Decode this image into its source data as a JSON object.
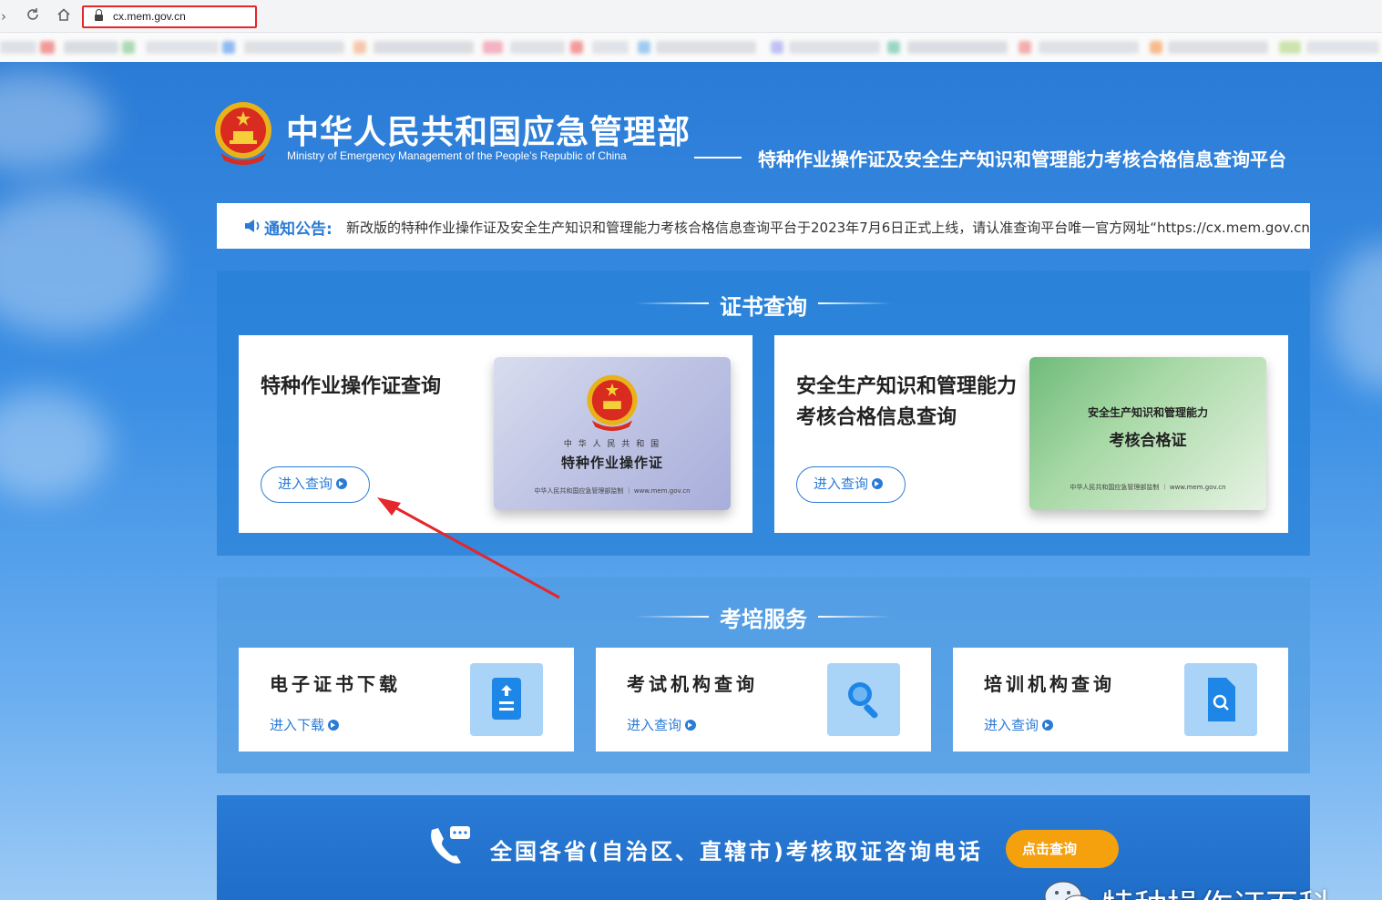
{
  "browser": {
    "url": "cx.mem.gov.cn",
    "back_icon": "back-icon",
    "reload_icon": "reload-icon",
    "home_icon": "home-icon"
  },
  "header": {
    "title": "中华人民共和国应急管理部",
    "subtitle": "Ministry of Emergency Management of the People’s Republic of China",
    "platform": "特种作业操作证及安全生产知识和管理能力考核合格信息查询平台"
  },
  "notice": {
    "label": "通知公告:",
    "text": "新改版的特种作业操作证及安全生产知识和管理能力考核合格信息查询平台于2023年7月6日正式上线，请认准查询平台唯一官方网址“https://cx.mem.gov.cn”"
  },
  "cert_section": {
    "title": "证书查询",
    "cards": [
      {
        "title": "特种作业操作证查询",
        "button": "进入查询",
        "card_country": "中 华 人 民 共 和 国",
        "card_name": "特种作业操作证",
        "card_footer": "中华人民共和国应急管理部监制 ｜ www.mem.gov.cn"
      },
      {
        "title_line1": "安全生产知识和管理能力",
        "title_line2": "考核合格信息查询",
        "button": "进入查询",
        "card_top": "安全生产知识和管理能力",
        "card_name": "考核合格证",
        "card_footer": "中华人民共和国应急管理部监制 ｜ www.mem.gov.cn"
      }
    ]
  },
  "train_section": {
    "title": "考培服务",
    "items": [
      {
        "title": "电子证书下载",
        "link": "进入下载"
      },
      {
        "title": "考试机构查询",
        "link": "进入查询"
      },
      {
        "title": "培训机构查询",
        "link": "进入查询"
      }
    ]
  },
  "phone_section": {
    "text": "全国各省(自治区、直辖市)考核取证咨询电话",
    "button": "点击查询"
  },
  "watermark": {
    "text": "特种操作证百科"
  },
  "colors": {
    "accent": "#2a7bd6",
    "highlight": "#e5262a",
    "button_orange": "#f5a10e"
  }
}
